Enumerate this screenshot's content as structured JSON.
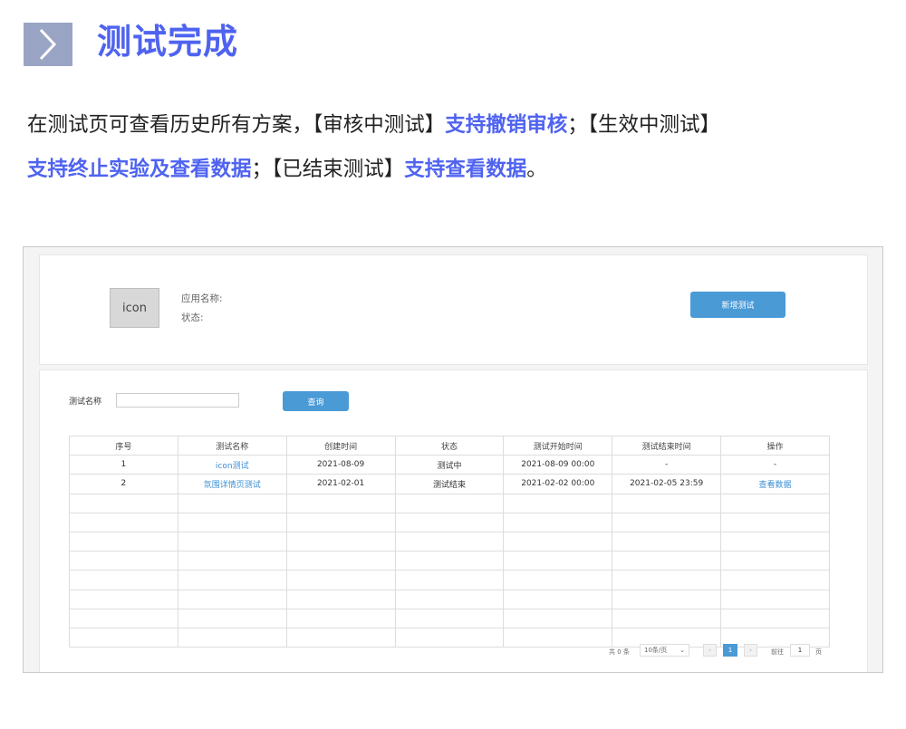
{
  "header": {
    "title": "测试完成"
  },
  "description": {
    "p1": "在测试页可查看历史所有方案，【审核中测试】",
    "p2": "支持撤销审核",
    "p3": "；【生效中测试】",
    "p4": "支持终止实验及查看数据",
    "p5": "；【已结束测试】",
    "p6": "支持查看数据",
    "p7": "。"
  },
  "app": {
    "icon_text": "icon",
    "name_label": "应用名称:",
    "status_label": "状态:",
    "new_test_button": "新增测试"
  },
  "filter": {
    "label": "测试名称",
    "value": "",
    "placeholder": "",
    "query_button": "查询"
  },
  "table": {
    "headers": [
      "序号",
      "测试名称",
      "创建时间",
      "状态",
      "测试开始时间",
      "测试结束时间",
      "操作"
    ],
    "rows": [
      {
        "no": "1",
        "name": "icon测试",
        "created": "2021-08-09",
        "status": "测试中",
        "start": "2021-08-09 00:00",
        "end": "-",
        "action": "-"
      },
      {
        "no": "2",
        "name": "氛围详情页测试",
        "created": "2021-02-01",
        "status": "测试结束",
        "start": "2021-02-02 00:00",
        "end": "2021-02-05 23:59",
        "action": "查看数据"
      }
    ]
  },
  "pagination": {
    "total": "共 0 条",
    "page_size": "10条/页",
    "current": "1",
    "goto_label": "前往",
    "goto_value": "1",
    "page_unit": "页"
  },
  "colors": {
    "accent": "#4f63f0",
    "button": "#4a9ad6",
    "link": "#3b8fd6",
    "header_icon_bg": "#9aa4c4"
  }
}
